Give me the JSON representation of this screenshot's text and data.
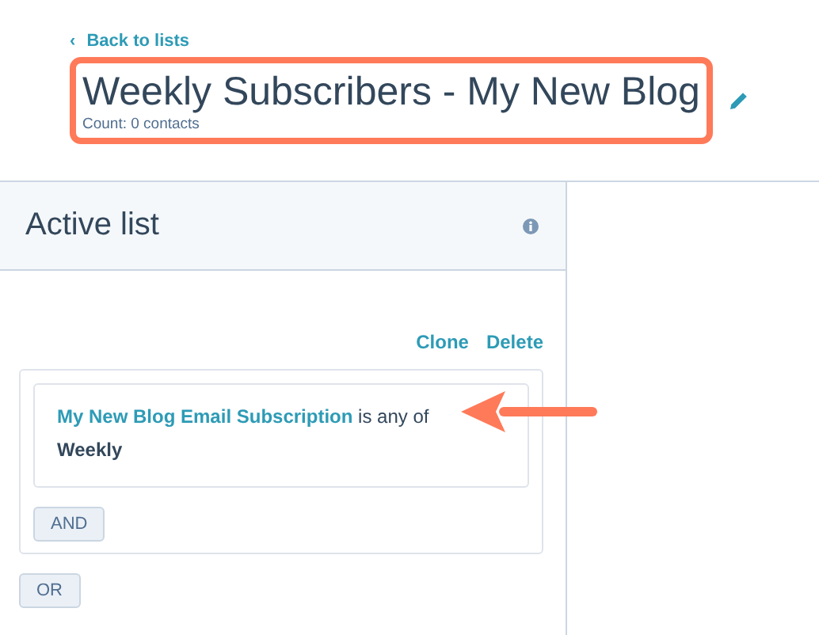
{
  "header": {
    "back_link": "Back to lists",
    "back_icon": "‹",
    "title": "Weekly Subscribers - My New Blog",
    "count": "Count: 0 contacts",
    "highlighted": true
  },
  "panel": {
    "title": "Active list",
    "actions": [
      "Clone",
      "Delete"
    ],
    "filter": {
      "property": "My New Blog Email Subscription",
      "operator": "is any of",
      "value": "Weekly",
      "pointed": true
    },
    "and_button": "AND",
    "or_button": "OR"
  }
}
